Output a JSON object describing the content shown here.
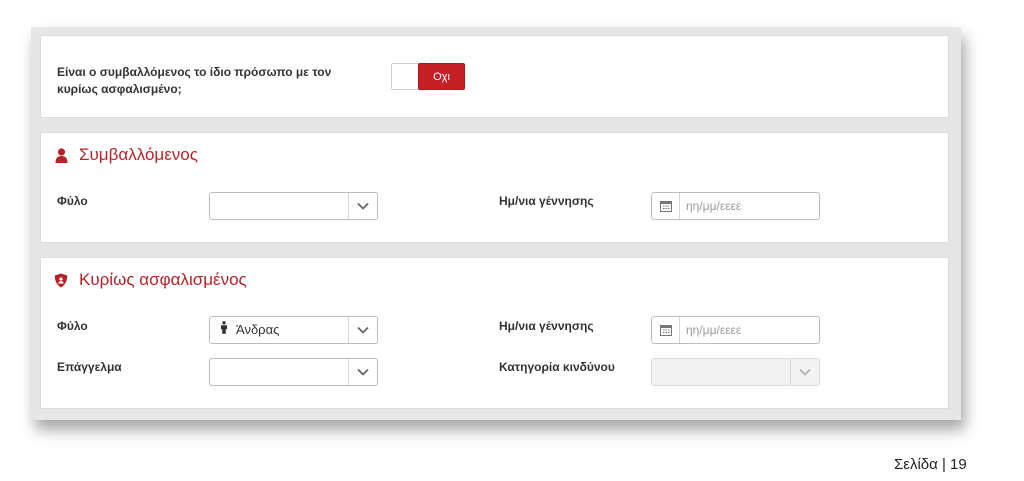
{
  "question": {
    "label_line1": "Είναι ο συμβαλλόμενος το ίδιο πρόσωπο με τον",
    "label_line2": "κυρίως ασφαλισμένο;",
    "toggle_value": "Οχι"
  },
  "contractor": {
    "title": "Συμβαλλόμενος",
    "gender_label": "Φύλο",
    "gender_value": "",
    "dob_label": "Ημ/νια γέννησης",
    "dob_placeholder": "ηη/μμ/εεεε"
  },
  "insured": {
    "title": "Κυρίως ασφαλισμένος",
    "gender_label": "Φύλο",
    "gender_value": "Άνδρας",
    "dob_label": "Ημ/νια γέννησης",
    "dob_placeholder": "ηη/μμ/εεεε",
    "occupation_label": "Επάγγελμα",
    "occupation_value": "",
    "risk_label": "Κατηγορία κινδύνου",
    "risk_value": ""
  },
  "page_number": "Σελίδα | 19",
  "colors": {
    "accent": "#c62027",
    "title": "#b5232a"
  },
  "icons": {
    "contractor": "person-icon",
    "insured": "shield-icon",
    "male": "male-icon",
    "calendar": "calendar-icon",
    "dropdown": "chevron-down-icon"
  }
}
